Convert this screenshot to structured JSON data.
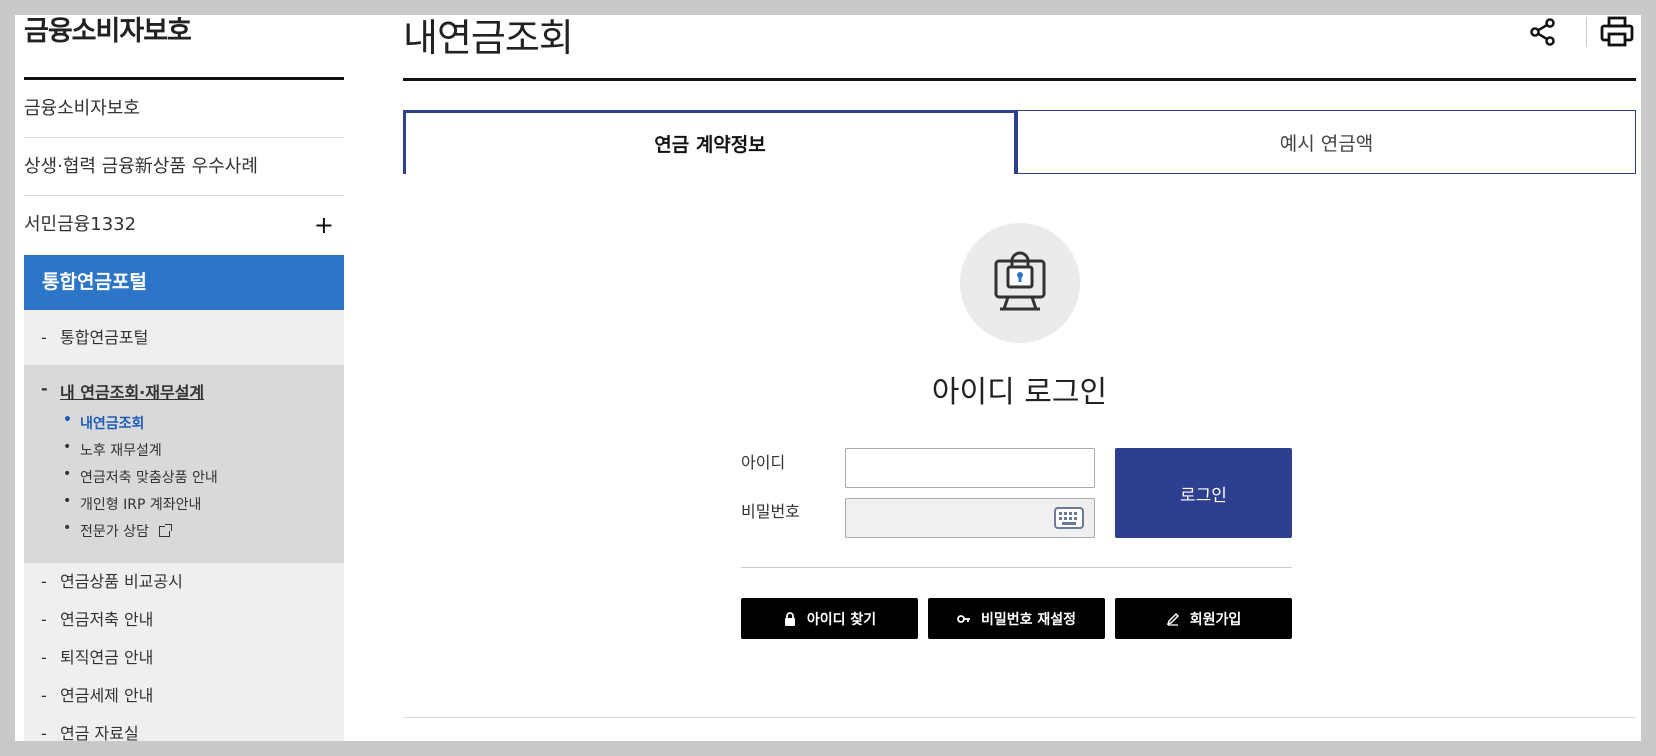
{
  "sidebar": {
    "title": "금융소비자보호",
    "top_items": [
      {
        "label": "금융소비자보호"
      },
      {
        "label": "상생·협력 금융新상품 우수사례"
      },
      {
        "label": "서민금융1332",
        "expand": "+"
      }
    ],
    "active_section": "통합연금포털",
    "sub_items": [
      {
        "label": "통합연금포털",
        "marker": "-"
      },
      {
        "label": "내 연금조회·재무설계",
        "marker": "-"
      },
      {
        "label": "연금상품 비교공시",
        "marker": "-"
      },
      {
        "label": "연금저축 안내",
        "marker": "-"
      },
      {
        "label": "퇴직연금 안내",
        "marker": "-"
      },
      {
        "label": "연금세제 안내",
        "marker": "-"
      },
      {
        "label": "연금 자료실",
        "marker": "-"
      }
    ],
    "depth3": [
      {
        "label": "내연금조회",
        "bullet": "•"
      },
      {
        "label": "노후 재무설계",
        "bullet": "•"
      },
      {
        "label": "연금저축 맞춤상품 안내",
        "bullet": "•"
      },
      {
        "label": "개인형 IRP 계좌안내",
        "bullet": "•"
      },
      {
        "label": "전문가 상담",
        "bullet": "•"
      }
    ]
  },
  "header": {
    "page_title": "내연금조회",
    "share_icon": "share-icon",
    "print_icon": "print-icon"
  },
  "tabs": [
    {
      "label": "연금 계약정보",
      "active": true
    },
    {
      "label": "예시 연금액",
      "active": false
    }
  ],
  "login": {
    "icon": "monitor-lock-icon",
    "heading": "아이디 로그인",
    "id_label": "아이디",
    "id_value": "",
    "pw_label": "비밀번호",
    "pw_value": "",
    "keyboard_icon": "keyboard-icon",
    "submit_label": "로그인"
  },
  "actions": [
    {
      "label": "아이디 찾기",
      "icon": "lock-icon"
    },
    {
      "label": "비밀번호 재설정",
      "icon": "key-icon"
    },
    {
      "label": "회원가입",
      "icon": "pen-icon"
    }
  ],
  "colors": {
    "navy": "#2d3f8e",
    "blue_active": "#2d75c6",
    "current_link": "#1e5dbc"
  }
}
